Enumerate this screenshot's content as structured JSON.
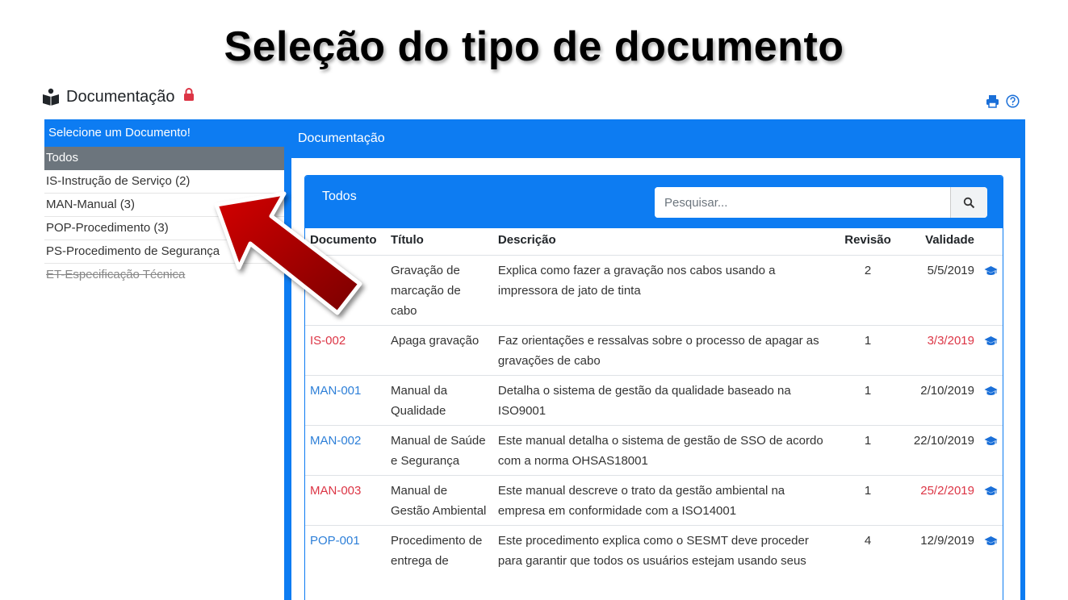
{
  "slide_title": "Seleção do tipo de documento",
  "page": {
    "title": "Documentação"
  },
  "icons": {
    "book": "book-reader-icon",
    "lock": "lock-icon",
    "print": "print-icon",
    "help": "help-icon",
    "search": "search-icon",
    "cap": "graduation-cap-icon",
    "arrow": "red-arrow-icon"
  },
  "colors": {
    "primary": "#0d7cf2",
    "active": "#6c757d",
    "link": "#2d7fd8",
    "danger": "#dc3545",
    "arrow": "#b00000"
  },
  "sidebar": {
    "header": "Selecione um Documento!",
    "items": [
      {
        "label": "Todos",
        "state": "active"
      },
      {
        "label": "IS-Instrução de Serviço (2)",
        "state": "normal"
      },
      {
        "label": "MAN-Manual (3)",
        "state": "normal"
      },
      {
        "label": "POP-Procedimento (3)",
        "state": "normal"
      },
      {
        "label": "PS-Procedimento de Segurança",
        "state": "normal"
      },
      {
        "label": "ET-Especificação Técnica",
        "state": "disabled"
      }
    ]
  },
  "main": {
    "header": "Documentação",
    "card_title": "Todos",
    "search_placeholder": "Pesquisar...",
    "columns": [
      "Documento",
      "Título",
      "Descrição",
      "Revisão",
      "Validade"
    ],
    "rows": [
      {
        "code": "",
        "code_status": "normal",
        "title": "Gravação de marcação de cabo",
        "description": "Explica como fazer a gravação nos cabos usando a impressora de jato de tinta",
        "revision": "2",
        "validity": "5/5/2019",
        "validity_status": "normal"
      },
      {
        "code": "IS-002",
        "code_status": "overdue",
        "title": "Apaga gravação",
        "description": "Faz orientações e ressalvas sobre o processo de apagar as gravações de cabo",
        "revision": "1",
        "validity": "3/3/2019",
        "validity_status": "overdue"
      },
      {
        "code": "MAN-001",
        "code_status": "normal",
        "title": "Manual da Qualidade",
        "description": "Detalha o sistema de gestão da qualidade baseado na ISO9001",
        "revision": "1",
        "validity": "2/10/2019",
        "validity_status": "normal"
      },
      {
        "code": "MAN-002",
        "code_status": "normal",
        "title": "Manual de Saúde e Segurança",
        "description": "Este manual detalha o sistema de gestão de SSO de acordo com a norma OHSAS18001",
        "revision": "1",
        "validity": "22/10/2019",
        "validity_status": "normal"
      },
      {
        "code": "MAN-003",
        "code_status": "overdue",
        "title": "Manual de Gestão Ambiental",
        "description": "Este manual descreve o trato da gestão ambiental na empresa em conformidade com a ISO14001",
        "revision": "1",
        "validity": "25/2/2019",
        "validity_status": "overdue"
      },
      {
        "code": "POP-001",
        "code_status": "normal",
        "title": "Procedimento de entrega de",
        "description": "Este procedimento explica como o SESMT deve proceder para garantir que todos os usuários estejam usando seus",
        "revision": "4",
        "validity": "12/9/2019",
        "validity_status": "normal"
      }
    ]
  }
}
